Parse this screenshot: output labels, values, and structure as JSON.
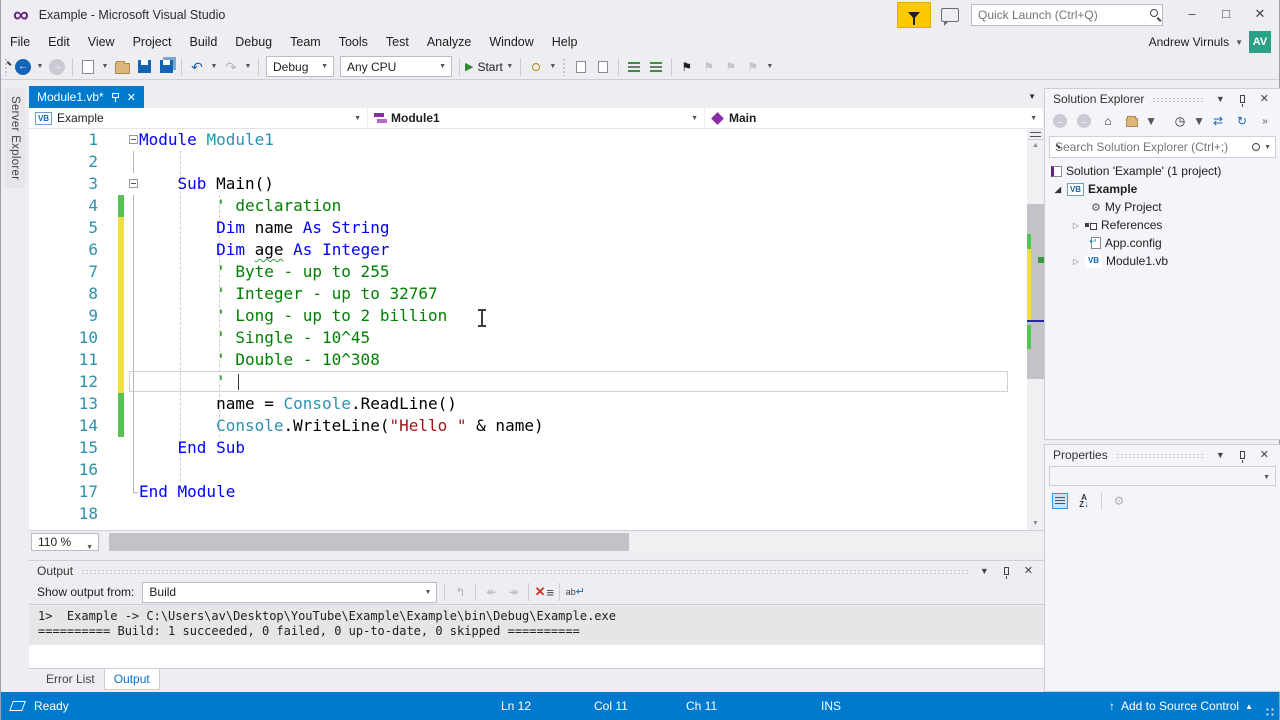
{
  "colors": {
    "accent": "#007acc",
    "chrome": "#eeeef2",
    "keyword": "#0000ff",
    "type": "#2b91af",
    "comment": "#008000",
    "string": "#a31515",
    "statusbar": "#007acc",
    "avatar": "#2aa186",
    "flag": "#fdca00"
  },
  "title_bar": {
    "title": "Example - Microsoft Visual Studio",
    "quick_launch_placeholder": "Quick Launch (Ctrl+Q)",
    "minimize": "–",
    "maximize": "□",
    "close": "✕"
  },
  "menu_bar": {
    "items": [
      "File",
      "Edit",
      "View",
      "Project",
      "Build",
      "Debug",
      "Team",
      "Tools",
      "Test",
      "Analyze",
      "Window",
      "Help"
    ],
    "user_name": "Andrew Virnuls",
    "avatar_initials": "AV"
  },
  "toolbar": {
    "configuration": "Debug",
    "platform": "Any CPU",
    "start_label": "Start"
  },
  "left_strip": {
    "tab_label": "Server Explorer"
  },
  "editor": {
    "tab_label": "Module1.vb*",
    "breadcrumb": [
      {
        "label": "Example",
        "icon": "vb-project-icon"
      },
      {
        "label": "Module1",
        "icon": "module-icon"
      },
      {
        "label": "Main",
        "icon": "method-icon"
      }
    ],
    "zoom_level": "110 %",
    "cursor": {
      "line": 12,
      "column": 11
    },
    "lines": [
      {
        "n": 1,
        "fold": "-",
        "bar": "",
        "cur": false,
        "tokens": [
          [
            "kw",
            "Module"
          ],
          [
            "pl",
            " "
          ],
          [
            "ty",
            "Module1"
          ]
        ]
      },
      {
        "n": 2,
        "fold": "|",
        "bar": "",
        "cur": false,
        "tokens": []
      },
      {
        "n": 3,
        "fold": "-",
        "bar": "",
        "cur": false,
        "tokens": [
          [
            "pl",
            "    "
          ],
          [
            "kw",
            "Sub"
          ],
          [
            "pl",
            " Main()"
          ]
        ]
      },
      {
        "n": 4,
        "fold": "|",
        "bar": "g",
        "cur": false,
        "tokens": [
          [
            "pl",
            "        "
          ],
          [
            "co",
            "' declaration"
          ]
        ]
      },
      {
        "n": 5,
        "fold": "|",
        "bar": "y",
        "cur": false,
        "tokens": [
          [
            "pl",
            "        "
          ],
          [
            "kw",
            "Dim"
          ],
          [
            "pl",
            " name "
          ],
          [
            "kw",
            "As"
          ],
          [
            "pl",
            " "
          ],
          [
            "kw",
            "String"
          ]
        ]
      },
      {
        "n": 6,
        "fold": "|",
        "bar": "y",
        "cur": false,
        "tokens": [
          [
            "pl",
            "        "
          ],
          [
            "kw",
            "Dim"
          ],
          [
            "pl",
            " "
          ],
          [
            "sq",
            "age"
          ],
          [
            "pl",
            " "
          ],
          [
            "kw",
            "As"
          ],
          [
            "pl",
            " "
          ],
          [
            "kw",
            "Integer"
          ]
        ]
      },
      {
        "n": 7,
        "fold": "|",
        "bar": "y",
        "cur": false,
        "tokens": [
          [
            "pl",
            "        "
          ],
          [
            "co",
            "' Byte - up to 255"
          ]
        ]
      },
      {
        "n": 8,
        "fold": "|",
        "bar": "y",
        "cur": false,
        "tokens": [
          [
            "pl",
            "        "
          ],
          [
            "co",
            "' Integer - up to 32767"
          ]
        ]
      },
      {
        "n": 9,
        "fold": "|",
        "bar": "y",
        "cur": false,
        "tokens": [
          [
            "pl",
            "        "
          ],
          [
            "co",
            "' Long - up to 2 billion"
          ]
        ]
      },
      {
        "n": 10,
        "fold": "|",
        "bar": "y",
        "cur": false,
        "tokens": [
          [
            "pl",
            "        "
          ],
          [
            "co",
            "' Single - 10^45"
          ]
        ]
      },
      {
        "n": 11,
        "fold": "|",
        "bar": "y",
        "cur": false,
        "tokens": [
          [
            "pl",
            "        "
          ],
          [
            "co",
            "' Double - 10^308"
          ]
        ]
      },
      {
        "n": 12,
        "fold": "|",
        "bar": "y",
        "cur": true,
        "tokens": [
          [
            "pl",
            "        "
          ],
          [
            "co",
            "'"
          ]
        ]
      },
      {
        "n": 13,
        "fold": "|",
        "bar": "g",
        "cur": false,
        "tokens": [
          [
            "pl",
            "        name = "
          ],
          [
            "ty",
            "Console"
          ],
          [
            "pl",
            ".ReadLine()"
          ]
        ]
      },
      {
        "n": 14,
        "fold": "|",
        "bar": "g",
        "cur": false,
        "tokens": [
          [
            "pl",
            "        "
          ],
          [
            "ty",
            "Console"
          ],
          [
            "pl",
            ".WriteLine("
          ],
          [
            "st",
            "\"Hello \""
          ],
          [
            "pl",
            " & name)"
          ]
        ]
      },
      {
        "n": 15,
        "fold": "|",
        "bar": "",
        "cur": false,
        "tokens": [
          [
            "pl",
            "    "
          ],
          [
            "kw",
            "End Sub"
          ]
        ]
      },
      {
        "n": 16,
        "fold": "|",
        "bar": "",
        "cur": false,
        "tokens": []
      },
      {
        "n": 17,
        "fold": "L",
        "bar": "",
        "cur": false,
        "tokens": [
          [
            "kw",
            "End Module"
          ]
        ]
      },
      {
        "n": 18,
        "fold": "",
        "bar": "",
        "cur": false,
        "tokens": []
      }
    ]
  },
  "solution_explorer": {
    "title": "Solution Explorer",
    "search_placeholder": "Search Solution Explorer (Ctrl+;)",
    "tree": [
      {
        "label": "Solution 'Example' (1 project)",
        "icon": "solution-icon"
      },
      {
        "label": "Example",
        "icon": "vb-project-icon"
      },
      {
        "label": "My Project",
        "icon": "wrench-icon"
      },
      {
        "label": "References",
        "icon": "references-icon"
      },
      {
        "label": "App.config",
        "icon": "config-file-icon"
      },
      {
        "label": "Module1.vb",
        "icon": "vb-file-icon"
      }
    ]
  },
  "properties": {
    "title": "Properties"
  },
  "output": {
    "title": "Output",
    "show_output_from_label": "Show output from:",
    "source": "Build",
    "lines": [
      "1>  Example -> C:\\Users\\av\\Desktop\\YouTube\\Example\\Example\\bin\\Debug\\Example.exe",
      "========== Build: 1 succeeded, 0 failed, 0 up-to-date, 0 skipped =========="
    ],
    "tabs": [
      {
        "label": "Error List"
      },
      {
        "label": "Output"
      }
    ]
  },
  "status_bar": {
    "message": "Ready",
    "line": "Ln 12",
    "column": "Col 11",
    "character": "Ch 11",
    "mode": "INS",
    "source_control_label": "Add to Source Control"
  }
}
